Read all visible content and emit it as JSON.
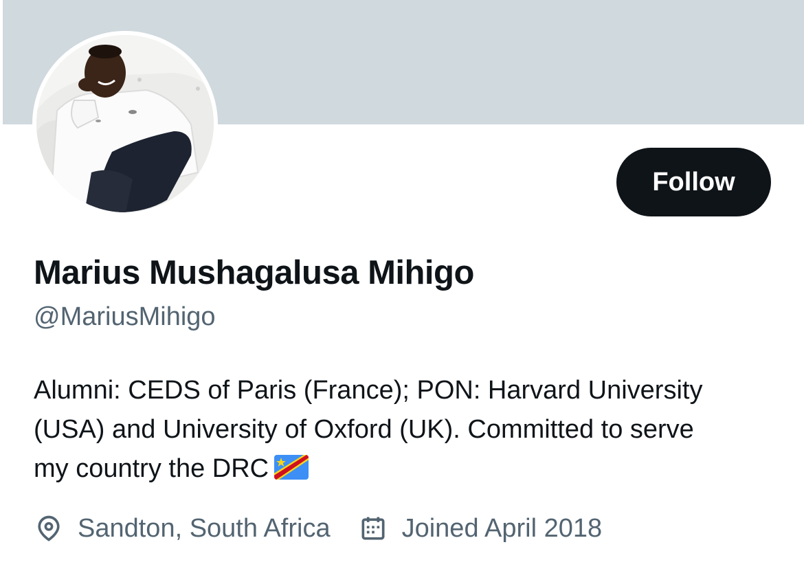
{
  "profile": {
    "display_name": "Marius Mushagalusa Mihigo",
    "handle": "@MariusMihigo",
    "bio_lines": [
      "Alumni: CEDS of Paris (France); PON: Harvard University",
      "(USA) and University of Oxford (UK). Committed to serve",
      "my country the DRC"
    ],
    "bio_emoji": "flag-drc-icon",
    "location": "Sandton, South Africa",
    "joined": "Joined April 2018"
  },
  "actions": {
    "follow_label": "Follow"
  },
  "icons": {
    "location": "location-pin-icon",
    "joined": "calendar-icon"
  },
  "colors": {
    "banner": "#cfd9de",
    "primary_text": "#0f1419",
    "secondary_text": "#536471",
    "follow_button_bg": "#0f1419",
    "follow_button_text": "#ffffff"
  }
}
